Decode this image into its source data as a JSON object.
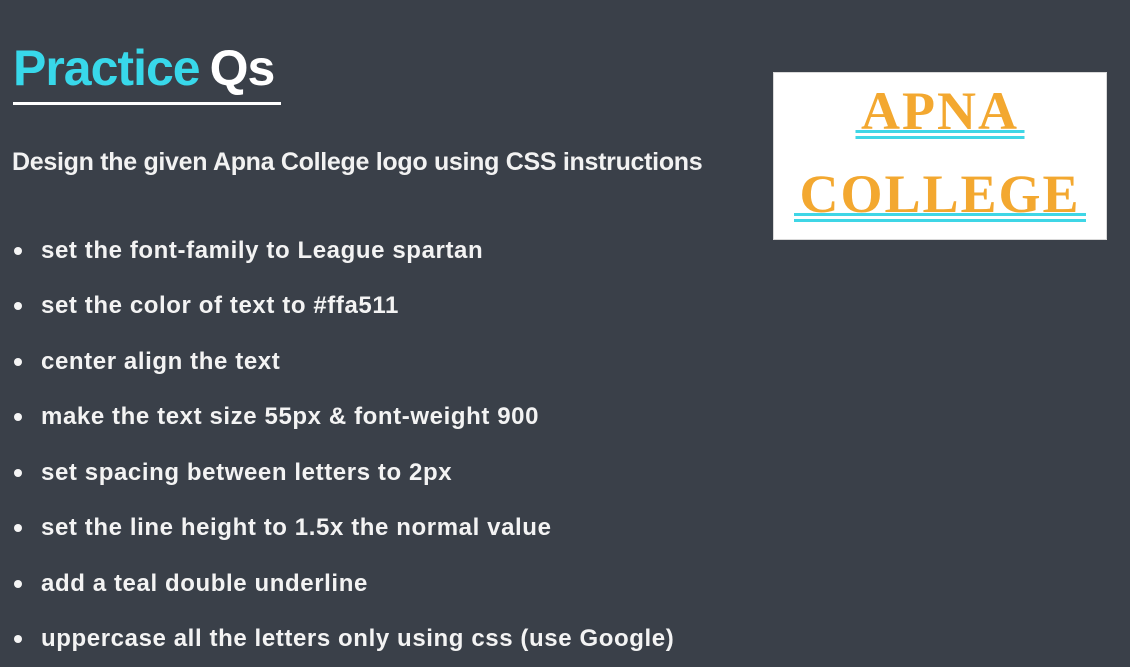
{
  "slide": {
    "title": {
      "part1": "Practice",
      "part2": "Qs"
    },
    "subtitle": "Design the given Apna College logo using CSS instructions",
    "bullets": [
      "set the font-family to League spartan",
      "set the color of text to #ffa511",
      "center align the text",
      "make the text size 55px & font-weight 900",
      "set spacing between letters to 2px",
      "set the line height to 1.5x the normal value",
      "add a teal double underline",
      "uppercase all the letters only using css (use Google)"
    ],
    "logo": {
      "line1": "APNA",
      "line2": "COLLEGE"
    }
  },
  "colors": {
    "background": "#3a4049",
    "title_accent": "#38d8ea",
    "title_secondary": "#ffffff",
    "text": "#f3f3f3",
    "logo_text": "#f3a830",
    "logo_underline": "#3fd6e6",
    "logo_background": "#ffffff"
  }
}
